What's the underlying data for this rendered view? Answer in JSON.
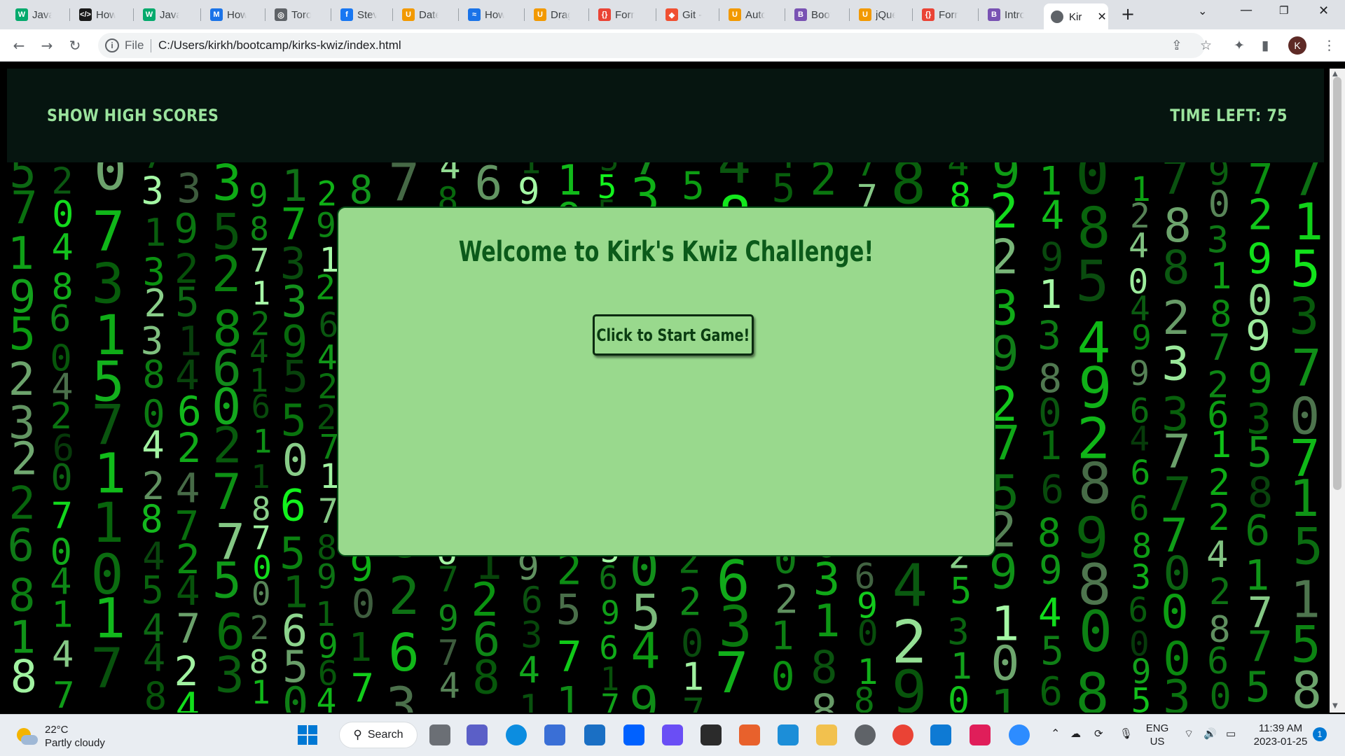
{
  "browser": {
    "tabs": [
      {
        "label": "JavaSc",
        "icon": "w3schools-icon",
        "color": "#04aa6d"
      },
      {
        "label": "How t",
        "icon": "code-icon",
        "color": "#1a1a1a"
      },
      {
        "label": "JavaSc",
        "icon": "w3schools-icon",
        "color": "#04aa6d"
      },
      {
        "label": "How t",
        "icon": "medium-icon",
        "color": "#1a73e8"
      },
      {
        "label": "Toront",
        "icon": "globe-icon",
        "color": "#5f6368"
      },
      {
        "label": "Stevie",
        "icon": "facebook-icon",
        "color": "#1877f2"
      },
      {
        "label": "Datep",
        "icon": "bootcamp-icon",
        "color": "#f29900"
      },
      {
        "label": "How T",
        "icon": "wave-icon",
        "color": "#1a73e8"
      },
      {
        "label": "Dragg",
        "icon": "bootcamp-icon",
        "color": "#f29900"
      },
      {
        "label": "Forma",
        "icon": "formatter-icon",
        "color": "#ea4335"
      },
      {
        "label": "Git - g",
        "icon": "git-icon",
        "color": "#f05032"
      },
      {
        "label": "Autoc",
        "icon": "bootcamp-icon",
        "color": "#f29900"
      },
      {
        "label": "Bootst",
        "icon": "bootstrap-icon",
        "color": "#7952b3"
      },
      {
        "label": "jQuery",
        "icon": "bootcamp-icon",
        "color": "#f29900"
      },
      {
        "label": "Forma",
        "icon": "formatter-icon",
        "color": "#ea4335"
      },
      {
        "label": "Introd",
        "icon": "bootstrap-icon",
        "color": "#7952b3"
      }
    ],
    "active_tab": {
      "label": "Kir",
      "icon": "globe-icon"
    },
    "new_tab": "+",
    "address": {
      "scheme_label": "File",
      "url": "C:/Users/kirkh/bootcamp/kirks-kwiz/index.html"
    },
    "profile_initial": "K"
  },
  "page": {
    "high_scores_label": "SHOW HIGH SCORES",
    "timer_text": "TIME LEFT: 75",
    "welcome_title": "Welcome to Kirk's Kwiz Challenge!",
    "start_button_label": "Click to Start Game!"
  },
  "taskbar": {
    "weather_temp": "22°C",
    "weather_desc": "Partly cloudy",
    "search_label": "Search",
    "language": "ENG",
    "region": "US",
    "time": "11:39 AM",
    "date": "2023-01-25",
    "notification_count": "1",
    "apps": [
      "task-view-icon",
      "teams-icon",
      "edge-icon",
      "store-icon",
      "mail-icon",
      "dropbox-icon",
      "clipchamp-icon",
      "cursor-icon",
      "office-icon",
      "remote-desktop-icon",
      "file-explorer-icon",
      "chrome-dev-icon",
      "chrome-icon",
      "vscode-icon",
      "slack-icon",
      "zoom-icon"
    ]
  }
}
